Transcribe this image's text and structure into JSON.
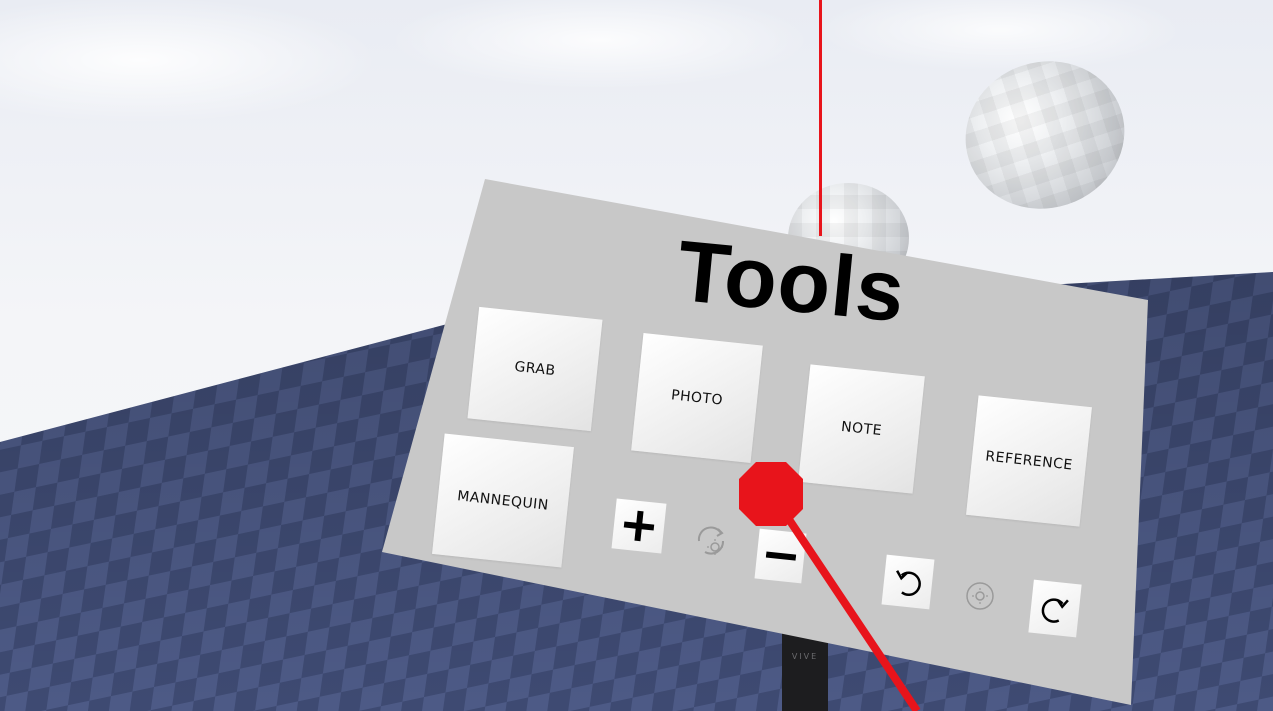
{
  "panel": {
    "title": "Tools",
    "tools": [
      {
        "id": "grab",
        "label": "GRAB"
      },
      {
        "id": "photo",
        "label": "PHOTO"
      },
      {
        "id": "note",
        "label": "NOTE"
      },
      {
        "id": "reference",
        "label": "REFERENCE"
      },
      {
        "id": "mannequin",
        "label": "MANNEQUIN"
      }
    ],
    "controls": {
      "plus_icon": "plus-icon",
      "minus_icon": "minus-icon",
      "undo_icon": "undo-icon",
      "redo_icon": "redo-icon",
      "rotate_light_icon": "rotate-light-icon",
      "orbit_light_icon": "orbit-light-icon"
    }
  },
  "controller": {
    "brand": "VIVE"
  },
  "colors": {
    "laser": "#e8141b",
    "panel": "#c8c8c8",
    "floor": "#3d4a73",
    "button": "#f0f0f0"
  }
}
